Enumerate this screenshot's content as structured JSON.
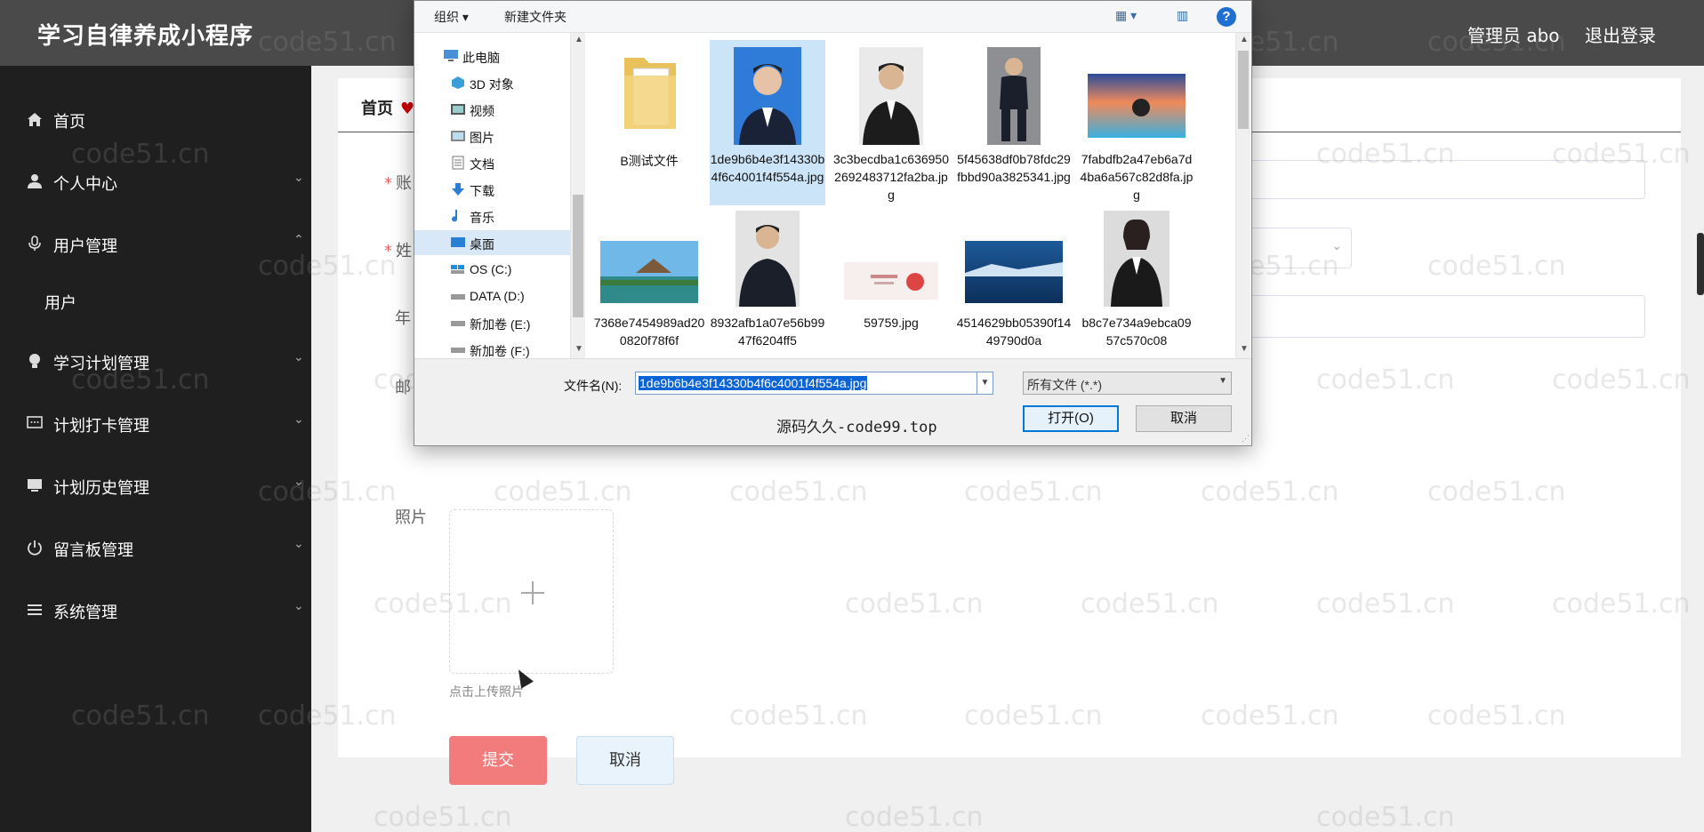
{
  "app": {
    "title": "学习自律养成小程序",
    "admin_label": "管理员 abo",
    "logout_label": "退出登录"
  },
  "sidebar": {
    "items": [
      {
        "label": "首页",
        "icon": "home-icon"
      },
      {
        "label": "个人中心",
        "icon": "user-icon"
      },
      {
        "label": "用户管理",
        "icon": "mic-icon"
      },
      {
        "label": "学习计划管理",
        "icon": "bulb-icon"
      },
      {
        "label": "计划打卡管理",
        "icon": "chat-icon"
      },
      {
        "label": "计划历史管理",
        "icon": "monitor-icon"
      },
      {
        "label": "留言板管理",
        "icon": "power-icon"
      },
      {
        "label": "系统管理",
        "icon": "list-icon"
      }
    ],
    "subitem_user": "用户"
  },
  "main": {
    "breadcrumb": "首页",
    "fields": {
      "account_label": "账",
      "name_label": "姓",
      "age_label": "年",
      "email_label": "邮",
      "photo_label": "照片"
    },
    "upload_tip": "点击上传照片",
    "submit_label": "提交",
    "cancel_label": "取消"
  },
  "watermark": "code51.cn",
  "dialog": {
    "toolbar": {
      "organize": "组织 ▾",
      "new_folder": "新建文件夹"
    },
    "nav": [
      {
        "label": "此电脑"
      },
      {
        "label": "3D 对象"
      },
      {
        "label": "视频"
      },
      {
        "label": "图片"
      },
      {
        "label": "文档"
      },
      {
        "label": "下载"
      },
      {
        "label": "音乐"
      },
      {
        "label": "桌面"
      },
      {
        "label": "OS (C:)"
      },
      {
        "label": "DATA (D:)"
      },
      {
        "label": "新加卷 (E:)"
      },
      {
        "label": "新加卷 (F:)"
      }
    ],
    "files": [
      {
        "name": "B测试文件"
      },
      {
        "name": "1de9b6b4e3f14330b4f6c4001f4f554a.jpg"
      },
      {
        "name": "3c3becdba1c6369502692483712fa2ba.jpg"
      },
      {
        "name": "5f45638df0b78fdc29fbbd90a3825341.jpg"
      },
      {
        "name": "7fabdfb2a47eb6a7d4ba6a567c82d8fa.jpg"
      },
      {
        "name": "7368e7454989ad200820f78f6f"
      },
      {
        "name": "8932afb1a07e56b9947f6204ff5"
      },
      {
        "name": "59759.jpg"
      },
      {
        "name": "4514629bb05390f1449790d0a"
      },
      {
        "name": "b8c7e734a9ebca0957c570c08"
      }
    ],
    "filename_label": "文件名(N):",
    "filename_value": "1de9b6b4e3f14330b4f6c4001f4f554a.jpg",
    "filetype_value": "所有文件 (*.*)",
    "source_text": "源码久久-code99.top",
    "open_label": "打开(O)",
    "cancel_label": "取消"
  },
  "colors": {
    "topbar": "#4a4a4a",
    "sidebar": "#1f1f1f",
    "submit": "#f27c7c",
    "selection": "#0a64d6"
  }
}
